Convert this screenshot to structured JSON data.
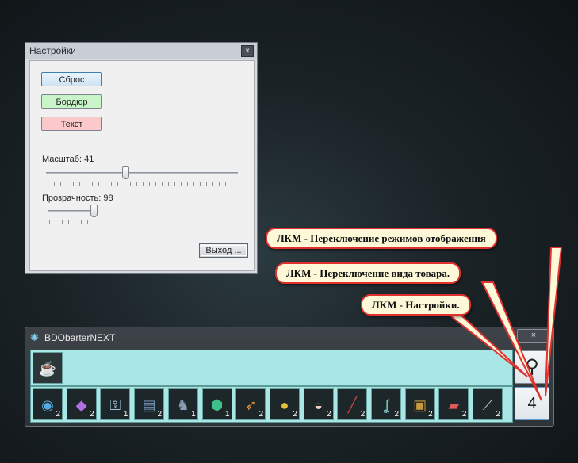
{
  "settings": {
    "title": "Настройки",
    "close_glyph": "×",
    "reset_label": "Сброс",
    "border_label": "Бордюр",
    "text_label": "Текст",
    "scale_label": "Масштаб: 41",
    "scale_value": 41,
    "opacity_label": "Прозрачность: 98",
    "opacity_value": 98,
    "exit_label": "Выход ..."
  },
  "callouts": {
    "display_modes": "ЛКМ - Переключение режимов отображения",
    "item_view": "ЛКМ - Переключение вида товара.",
    "settings": "ЛКМ - Настройки."
  },
  "barter": {
    "title": "BDObarterNEXT",
    "close_glyph": "×",
    "top_item_icon": "tea-cup-icon",
    "items": [
      {
        "icon": "orb-icon",
        "count": "2"
      },
      {
        "icon": "crystal-icon",
        "count": "2"
      },
      {
        "icon": "key-icon",
        "count": "1"
      },
      {
        "icon": "book-icon",
        "count": "2"
      },
      {
        "icon": "statue-icon",
        "count": "1"
      },
      {
        "icon": "gem-icon",
        "count": "1"
      },
      {
        "icon": "feather-icon",
        "count": "2"
      },
      {
        "icon": "gold-pile-icon",
        "count": "2"
      },
      {
        "icon": "shell-icon",
        "count": "2"
      },
      {
        "icon": "knife-icon",
        "count": "2"
      },
      {
        "icon": "hook-icon",
        "count": "2"
      },
      {
        "icon": "chest-icon",
        "count": "2"
      },
      {
        "icon": "scroll-icon",
        "count": "2"
      },
      {
        "icon": "dagger-icon",
        "count": "2"
      }
    ],
    "settings_button_glyph": "⚲",
    "mode_button_label": "4"
  },
  "colors": {
    "callout_bg": "#fdf8d7",
    "callout_border": "#e03030",
    "barter_area": "#a9e6e6",
    "border_btn": "#c9f5c9",
    "text_btn": "#fbc9c9"
  }
}
